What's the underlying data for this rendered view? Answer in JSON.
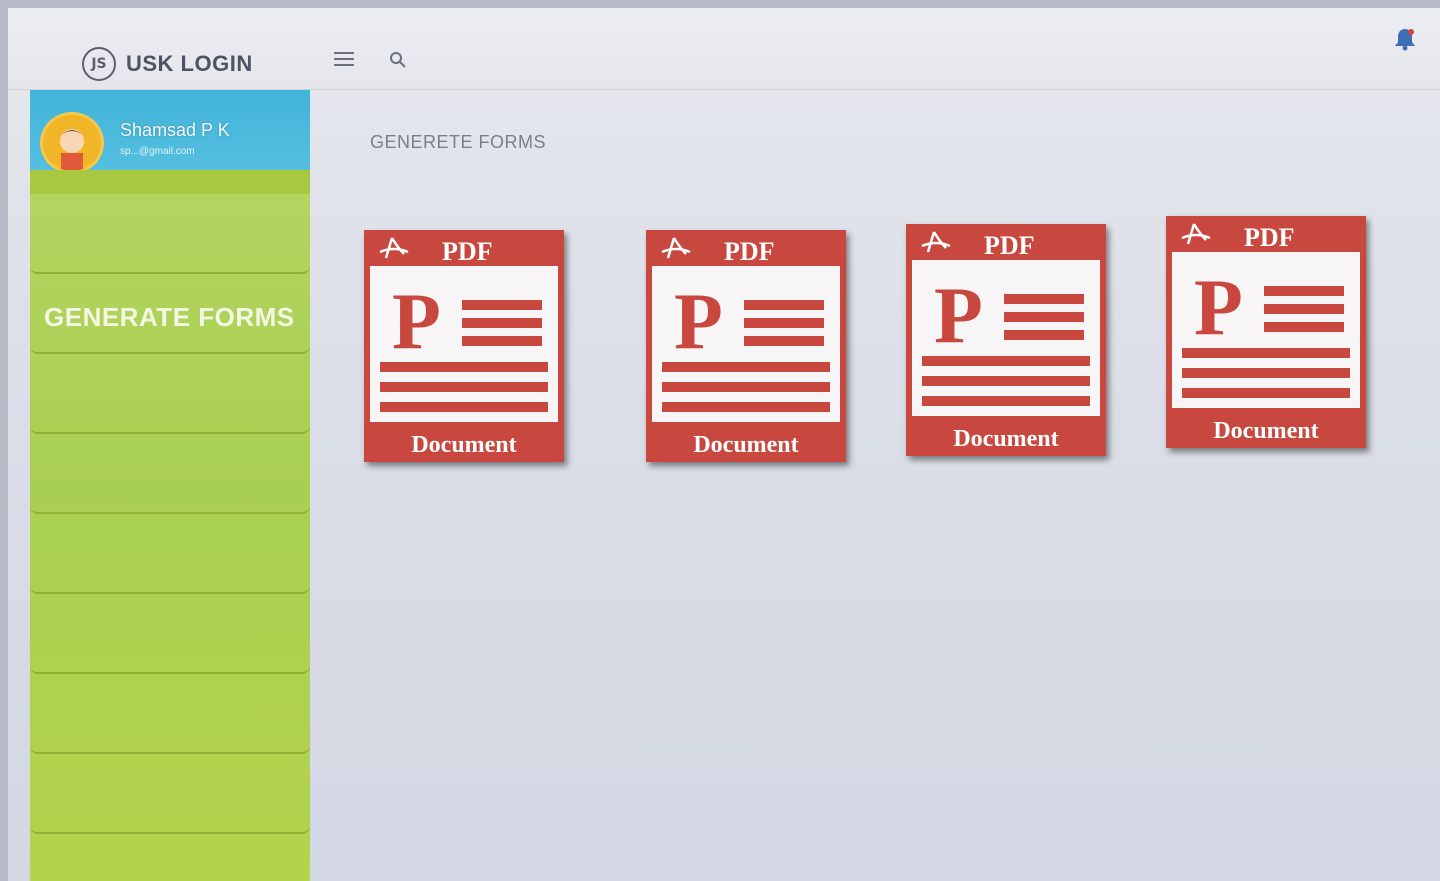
{
  "header": {
    "brand_logo": "JS",
    "brand_title": "USK LOGIN"
  },
  "profile": {
    "name": "Shamsad P K",
    "email": "sp...@gmail.com"
  },
  "sidebar": {
    "items": [
      {
        "label": ""
      },
      {
        "label": "GENERATE FORMS"
      },
      {
        "label": ""
      },
      {
        "label": ""
      },
      {
        "label": ""
      },
      {
        "label": ""
      },
      {
        "label": ""
      },
      {
        "label": ""
      }
    ]
  },
  "main": {
    "section_title": "GENERETE FORMS",
    "documents": [
      {
        "top_label": "PDF",
        "bottom_label": "Document"
      },
      {
        "top_label": "PDF",
        "bottom_label": "Document"
      },
      {
        "top_label": "PDF",
        "bottom_label": "Document"
      },
      {
        "top_label": "PDF",
        "bottom_label": "Document"
      }
    ]
  },
  "colors": {
    "pdf_red": "#c8483f",
    "sidebar_green": "#a9cf52",
    "profile_blue": "#40b4d9"
  },
  "icons": {
    "menu": "hamburger-icon",
    "search": "search-icon",
    "bell": "bell-icon",
    "acrobat": "acrobat-icon"
  }
}
